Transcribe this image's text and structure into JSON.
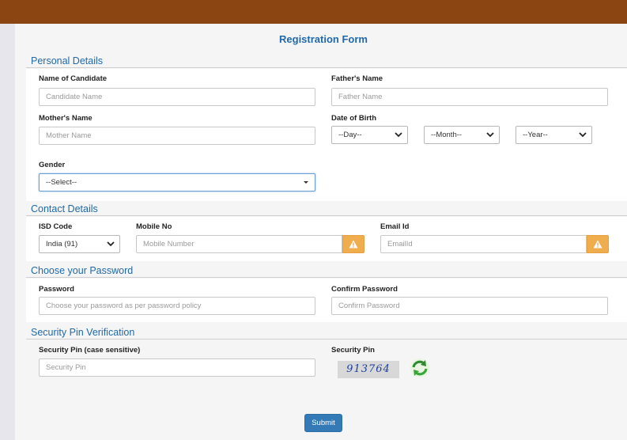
{
  "form_title": "Registration Form",
  "personal": {
    "heading": "Personal Details",
    "candidate_label": "Name of Candidate",
    "candidate_placeholder": "Candidate Name",
    "father_label": "Father's Name",
    "father_placeholder": "Father Name",
    "mother_label": "Mother's Name",
    "mother_placeholder": "Mother Name",
    "dob_label": "Date of Birth",
    "day_value": "--Day--",
    "month_value": "--Month--",
    "year_value": "--Year--",
    "gender_label": "Gender",
    "gender_value": "--Select--"
  },
  "contact": {
    "heading": "Contact Details",
    "isd_label": "ISD Code",
    "isd_value": "India (91)",
    "mobile_label": "Mobile No",
    "mobile_placeholder": "Mobile Number",
    "email_label": "Email Id",
    "email_placeholder": "EmailId"
  },
  "password": {
    "heading": "Choose your Password",
    "password_label": "Password",
    "password_placeholder": "Choose your password as per password policy",
    "confirm_label": "Confirm Password",
    "confirm_placeholder": "Confirm Password"
  },
  "security": {
    "heading": "Security Pin Verification",
    "pin_label": "Security Pin (case sensitive)",
    "pin_placeholder": "Security Pin",
    "captcha_label": "Security Pin",
    "captcha_text": "913764"
  },
  "submit_label": "Submit",
  "colors": {
    "topbar": "#8b4513",
    "heading": "#2169a8",
    "warning": "#f0ad4e",
    "submit": "#337ab7"
  }
}
